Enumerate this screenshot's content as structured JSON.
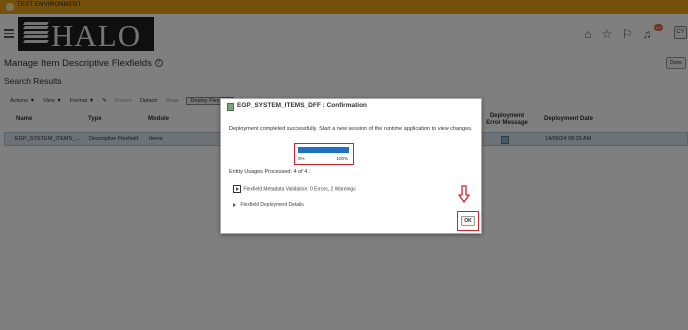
{
  "env_banner": "TEST ENVIRONMENT",
  "brand": {
    "logo_text": "HALO"
  },
  "header": {
    "notification_count": "10+",
    "avatar_initials": "CY"
  },
  "page": {
    "title": "Manage Item Descriptive Flexfields",
    "section": "Search Results",
    "done_label": "Done"
  },
  "toolbar": {
    "actions": "Actions ▼",
    "view": "View ▼",
    "format": "Format ▼",
    "freeze": "Freeze",
    "detach": "Detach",
    "wrap": "Wrap",
    "deploy": "Deploy Flexfield"
  },
  "table": {
    "headers": [
      "Name",
      "Type",
      "Module",
      "Deployment Error Message",
      "Deployment Date"
    ],
    "row": {
      "name": "EGP_SYSTEM_ITEMS_...",
      "type": "Descriptive Flexfield",
      "module": "Items",
      "date": "14/06/24 08:33 AM"
    }
  },
  "dialog": {
    "title": "EGP_SYSTEM_ITEMS_DFF : Confirmation",
    "message": "Deployment completed successfully. Start a new session of the runtime application to view changes.",
    "progress": {
      "fraction": 1.0,
      "low_label": "0%",
      "high_label": "100%"
    },
    "usages": "Entity Usages Processed: 4 of 4 .",
    "validation": "Flexfield Metadata Validation: 0 Errors, 2 Warnings",
    "deployment_details": "Flexfield Deployment Details",
    "ok_label": "OK"
  },
  "colors": {
    "accent_bar": "#e8a317",
    "highlight": "#d0242a",
    "progress": "#1f6fc4"
  }
}
